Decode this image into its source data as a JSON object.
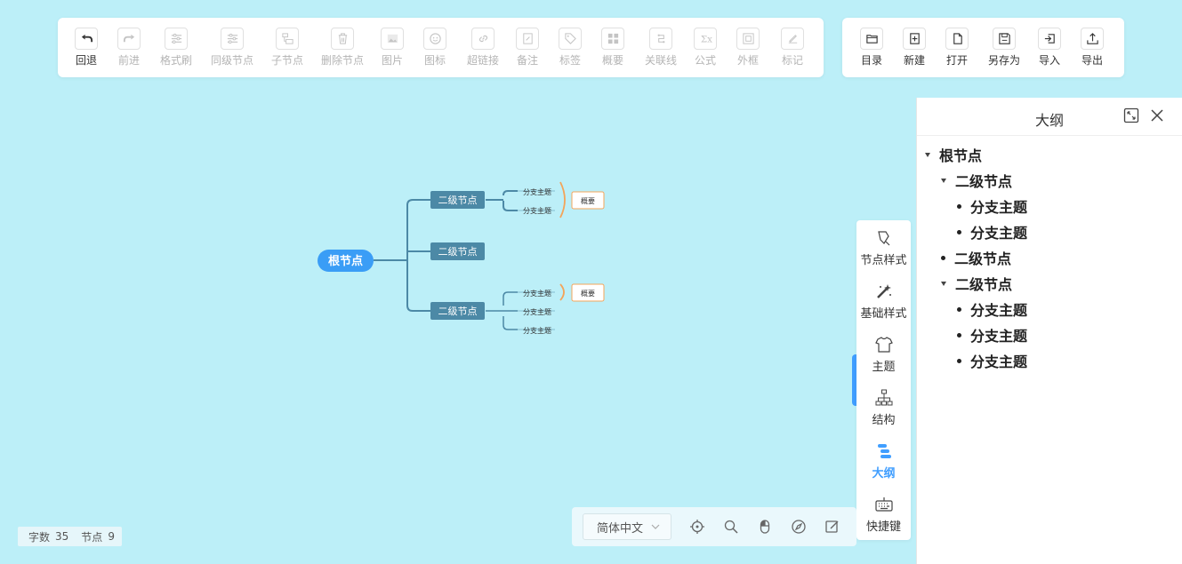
{
  "toolbar_main": [
    {
      "label": "回退",
      "icon": "undo-icon",
      "enabled": true
    },
    {
      "label": "前进",
      "icon": "redo-icon",
      "enabled": false
    },
    {
      "label": "格式刷",
      "icon": "format-brush-icon",
      "enabled": false
    },
    {
      "label": "同级节点",
      "icon": "sibling-node-icon",
      "enabled": false
    },
    {
      "label": "子节点",
      "icon": "child-node-icon",
      "enabled": false
    },
    {
      "label": "删除节点",
      "icon": "delete-icon",
      "enabled": false
    },
    {
      "label": "图片",
      "icon": "image-icon",
      "enabled": false
    },
    {
      "label": "图标",
      "icon": "emoji-icon",
      "enabled": false
    },
    {
      "label": "超链接",
      "icon": "link-icon",
      "enabled": false
    },
    {
      "label": "备注",
      "icon": "note-icon",
      "enabled": false
    },
    {
      "label": "标签",
      "icon": "tag-icon",
      "enabled": false
    },
    {
      "label": "概要",
      "icon": "summary-icon",
      "enabled": false
    },
    {
      "label": "关联线",
      "icon": "association-line-icon",
      "enabled": false
    },
    {
      "label": "公式",
      "icon": "formula-icon",
      "enabled": false
    },
    {
      "label": "外框",
      "icon": "outer-frame-icon",
      "enabled": false
    },
    {
      "label": "标记",
      "icon": "mark-icon",
      "enabled": false
    }
  ],
  "toolbar_file": [
    {
      "label": "目录",
      "icon": "folder-icon"
    },
    {
      "label": "新建",
      "icon": "new-file-icon"
    },
    {
      "label": "打开",
      "icon": "open-file-icon"
    },
    {
      "label": "另存为",
      "icon": "save-as-icon"
    },
    {
      "label": "导入",
      "icon": "import-icon"
    },
    {
      "label": "导出",
      "icon": "export-icon"
    }
  ],
  "mindmap": {
    "root": "根节点",
    "branches": [
      {
        "label": "二级节点",
        "children": [
          "分支主题",
          "分支主题"
        ],
        "summary": "概要"
      },
      {
        "label": "二级节点",
        "children": []
      },
      {
        "label": "二级节点",
        "children": [
          "分支主题",
          "分支主题",
          "分支主题"
        ],
        "summary": "概要"
      }
    ]
  },
  "outline": {
    "title": "大纲",
    "items": [
      {
        "label": "根节点",
        "level": 0,
        "type": "caret"
      },
      {
        "label": "二级节点",
        "level": 1,
        "type": "caret"
      },
      {
        "label": "分支主题",
        "level": 2,
        "type": "bullet"
      },
      {
        "label": "分支主题",
        "level": 2,
        "type": "bullet"
      },
      {
        "label": "二级节点",
        "level": 1,
        "type": "bullet"
      },
      {
        "label": "二级节点",
        "level": 1,
        "type": "caret"
      },
      {
        "label": "分支主题",
        "level": 2,
        "type": "bullet"
      },
      {
        "label": "分支主题",
        "level": 2,
        "type": "bullet"
      },
      {
        "label": "分支主题",
        "level": 2,
        "type": "bullet"
      }
    ]
  },
  "side_toolbar": [
    {
      "label": "节点样式",
      "icon": "node-style-icon",
      "active": false
    },
    {
      "label": "基础样式",
      "icon": "magic-wand-icon",
      "active": false
    },
    {
      "label": "主题",
      "icon": "shirt-icon",
      "active": false
    },
    {
      "label": "结构",
      "icon": "structure-icon",
      "active": false
    },
    {
      "label": "大纲",
      "icon": "outline-icon",
      "active": true
    },
    {
      "label": "快捷键",
      "icon": "keyboard-icon",
      "active": false
    }
  ],
  "bottom_bar": {
    "language": "简体中文",
    "icons": [
      "locate-icon",
      "zoom-icon",
      "mouse-icon",
      "navigator-icon",
      "edit-icon"
    ]
  },
  "status": {
    "word_count_label": "字数",
    "word_count": "35",
    "node_count_label": "节点",
    "node_count": "9"
  },
  "colors": {
    "canvas_bg": "#bceff8",
    "root_node": "#3a9df6",
    "second_node": "#4c89a6",
    "line": "#4c89a6",
    "summary_bracket": "#f3a45a",
    "accent": "#409eff"
  }
}
